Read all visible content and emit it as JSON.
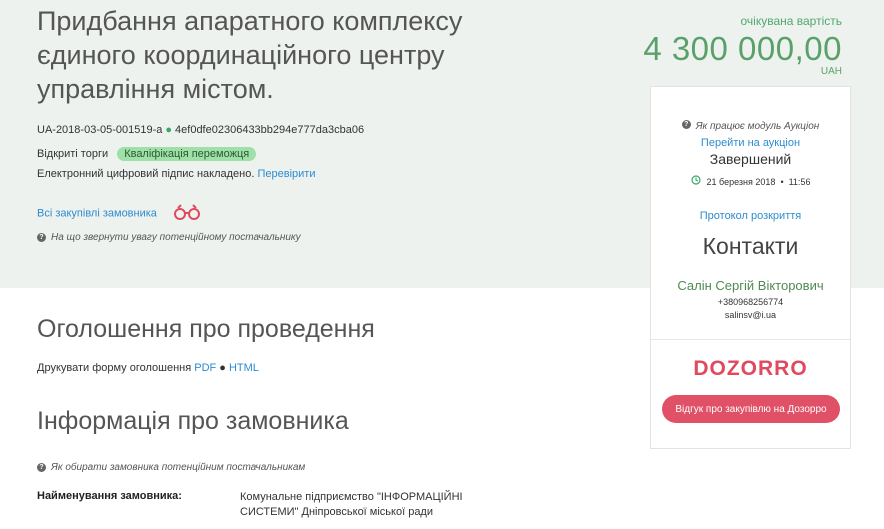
{
  "tender": {
    "title": "Придбання апаратного комплексу єдиного координаційного центру управління містом.",
    "id": "UA-2018-03-05-001519-a",
    "hash": "4ef0dfe02306433bb294e777da3cba06",
    "procurement_type": "Відкриті торги",
    "status_badge": "Кваліфікація переможця",
    "signature_text": "Електронний цифровий підпис накладено.",
    "verify_link": "Перевірити",
    "all_purchases_link": "Всі закупівлі замовника",
    "attention_note": "На що звернути увагу потенційному постачальнику"
  },
  "price": {
    "label": "очікувана вартість",
    "amount": "4 300 000,00",
    "currency": "UAH"
  },
  "sidebar": {
    "auction_help": "Як працює модуль Аукціон",
    "auction_link": "Перейти на аукціон",
    "auction_status": "Завершений",
    "auction_date": "21 березня 2018",
    "auction_time": "11:56",
    "protocol_link": "Протокол розкриття",
    "contacts_title": "Контакти",
    "contact_name": "Салін Сергій Вікторович",
    "contact_phone": "+380968256774",
    "contact_email": "salinsv@i.ua",
    "dozorro_logo": "DOZORRO",
    "feedback_button": "Відгук про закупівлю на Дозорро"
  },
  "announcement": {
    "title": "Оголошення про проведення",
    "print_label": "Друкувати форму оголошення",
    "pdf_link": "PDF",
    "html_link": "HTML"
  },
  "customer": {
    "title": "Інформація про замовника",
    "help_note": "Як обирати замовника потенційним постачальникам",
    "name_label": "Найменування замовника:",
    "name_value": "Комунальне підприємство \"ІНФОРМАЦІЙНІ СИСТЕМИ\" Дніпровської міської ради"
  }
}
